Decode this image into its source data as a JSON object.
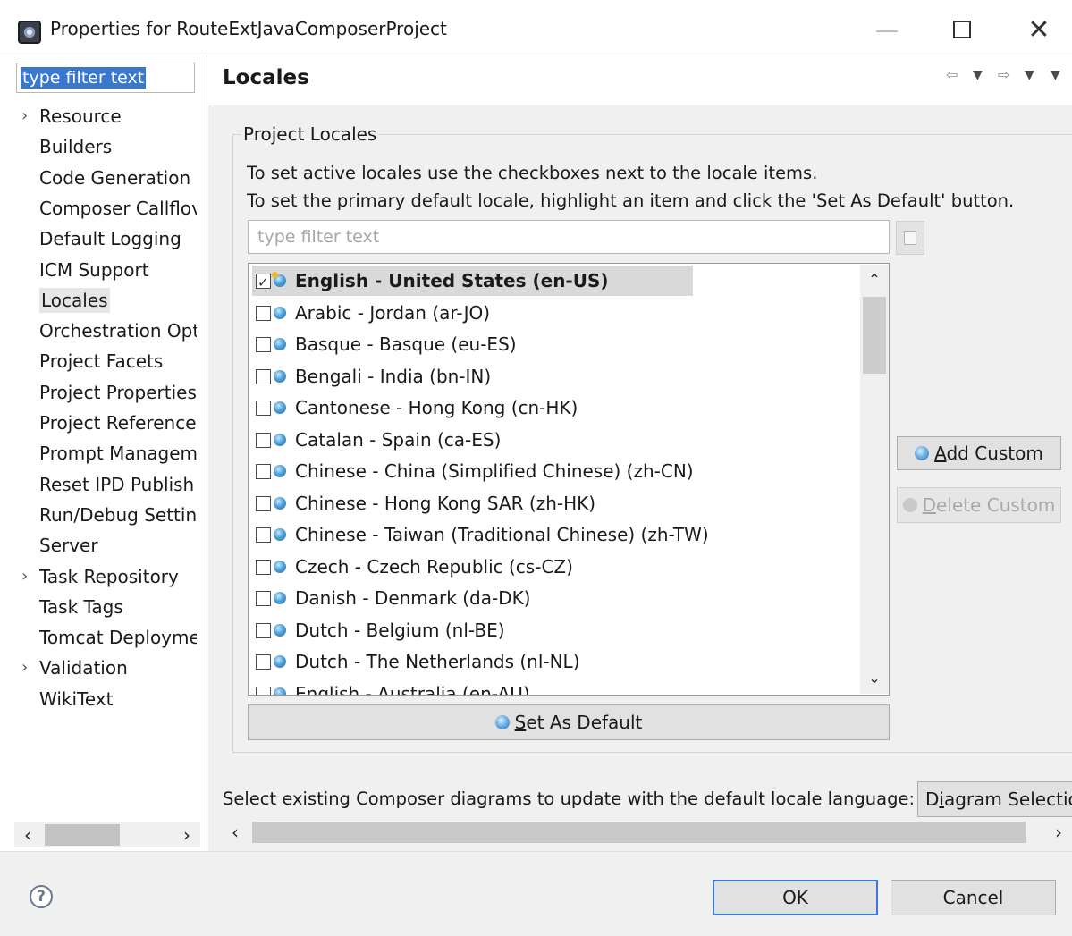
{
  "window": {
    "title": "Properties for RouteExtJavaComposerProject",
    "minimize_glyph": "—",
    "close_glyph": "✕"
  },
  "nav": {
    "filter_text": "type filter text",
    "items": [
      {
        "label": "Resource",
        "expandable": true
      },
      {
        "label": "Builders"
      },
      {
        "label": "Code Generation I"
      },
      {
        "label": "Composer Callflov"
      },
      {
        "label": "Default Logging"
      },
      {
        "label": "ICM Support"
      },
      {
        "label": "Locales",
        "selected": true
      },
      {
        "label": "Orchestration Opt"
      },
      {
        "label": "Project Facets"
      },
      {
        "label": "Project Properties"
      },
      {
        "label": "Project References"
      },
      {
        "label": "Prompt Managem"
      },
      {
        "label": "Reset IPD Publish"
      },
      {
        "label": "Run/Debug Settin"
      },
      {
        "label": "Server"
      },
      {
        "label": "Task Repository",
        "expandable": true
      },
      {
        "label": "Task Tags"
      },
      {
        "label": "Tomcat Deployme"
      },
      {
        "label": "Validation",
        "expandable": true
      },
      {
        "label": "WikiText"
      }
    ]
  },
  "page": {
    "title": "Locales",
    "group_label": "Project Locales",
    "instruction_1": "To set active locales use the checkboxes next to the locale items.",
    "instruction_2": "To set the primary default locale, highlight an item and click the 'Set As Default' button.",
    "filter_placeholder": "type filter text",
    "locales": [
      {
        "label": "English - United States (en-US)",
        "checked": true,
        "default": true
      },
      {
        "label": "Arabic - Jordan (ar-JO)",
        "checked": false
      },
      {
        "label": "Basque - Basque (eu-ES)",
        "checked": false
      },
      {
        "label": "Bengali - India (bn-IN)",
        "checked": false
      },
      {
        "label": "Cantonese - Hong Kong (cn-HK)",
        "checked": false
      },
      {
        "label": "Catalan - Spain (ca-ES)",
        "checked": false
      },
      {
        "label": "Chinese - China (Simplified Chinese) (zh-CN)",
        "checked": false
      },
      {
        "label": "Chinese - Hong Kong SAR (zh-HK)",
        "checked": false
      },
      {
        "label": "Chinese - Taiwan (Traditional Chinese) (zh-TW)",
        "checked": false
      },
      {
        "label": "Czech - Czech Republic (cs-CZ)",
        "checked": false
      },
      {
        "label": "Danish - Denmark (da-DK)",
        "checked": false
      },
      {
        "label": "Dutch - Belgium (nl-BE)",
        "checked": false
      },
      {
        "label": "Dutch - The Netherlands (nl-NL)",
        "checked": false
      },
      {
        "label": "English - Australia (en-AU)",
        "checked": false
      }
    ],
    "add_custom_underline": "A",
    "add_custom_rest": "dd Custom",
    "delete_custom_underline": "D",
    "delete_custom_rest": "elete Custom",
    "set_default_underline": "S",
    "set_default_rest": "et As Default",
    "diagram_prompt": "Select existing Composer diagrams to update with the default locale language:",
    "diagram_button_pre": "D",
    "diagram_button_underline": "i",
    "diagram_button_rest": "agram Selectio"
  },
  "footer": {
    "help_glyph": "?",
    "ok_label": "OK",
    "cancel_label": "Cancel"
  },
  "colors": {
    "selection": "#3a77cf",
    "default_button_border": "#3b78d8",
    "panel_bg": "#f0f0f0"
  }
}
